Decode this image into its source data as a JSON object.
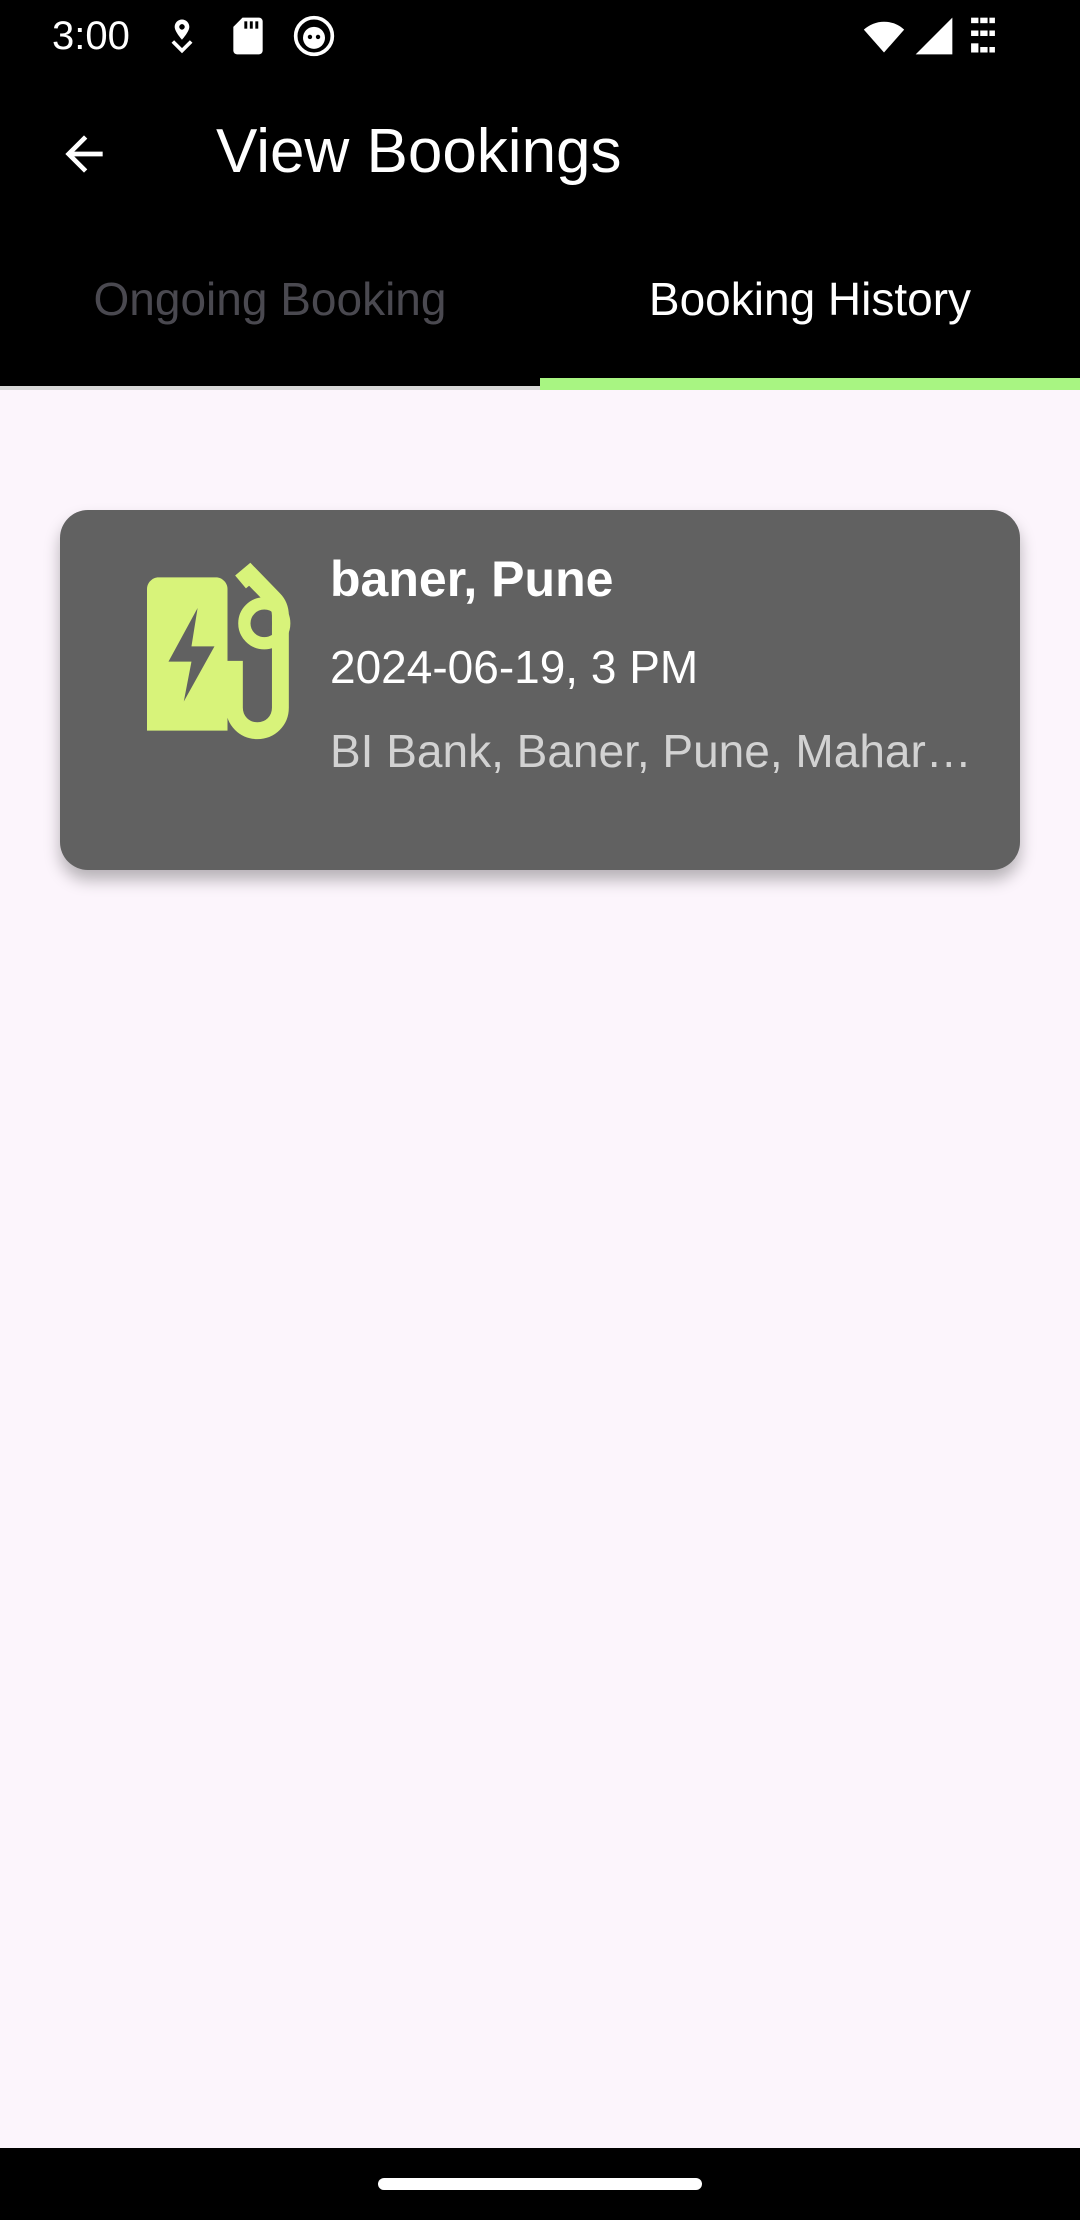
{
  "status_bar": {
    "time": "3:00",
    "left_icons": [
      "location-pin-icon",
      "sd-card-icon",
      "app-face-icon"
    ],
    "right_icons": [
      "wifi-icon",
      "cellular-signal-icon",
      "battery-icon"
    ]
  },
  "app_bar": {
    "back_icon": "arrow-back-icon",
    "title": "View Bookings"
  },
  "tabs": [
    {
      "label": "Ongoing Booking",
      "selected": false
    },
    {
      "label": "Booking History",
      "selected": true
    }
  ],
  "colors": {
    "tab_indicator": "#a8f582",
    "icon_accent": "#d8f37a",
    "card_bg": "#616161",
    "page_bg": "#fcf5fc"
  },
  "bookings": [
    {
      "icon": "ev-station-icon",
      "title": "baner, Pune",
      "datetime": "2024-06-19, 3 PM",
      "address": "BI Bank, Baner, Pune, Mahar…"
    }
  ]
}
